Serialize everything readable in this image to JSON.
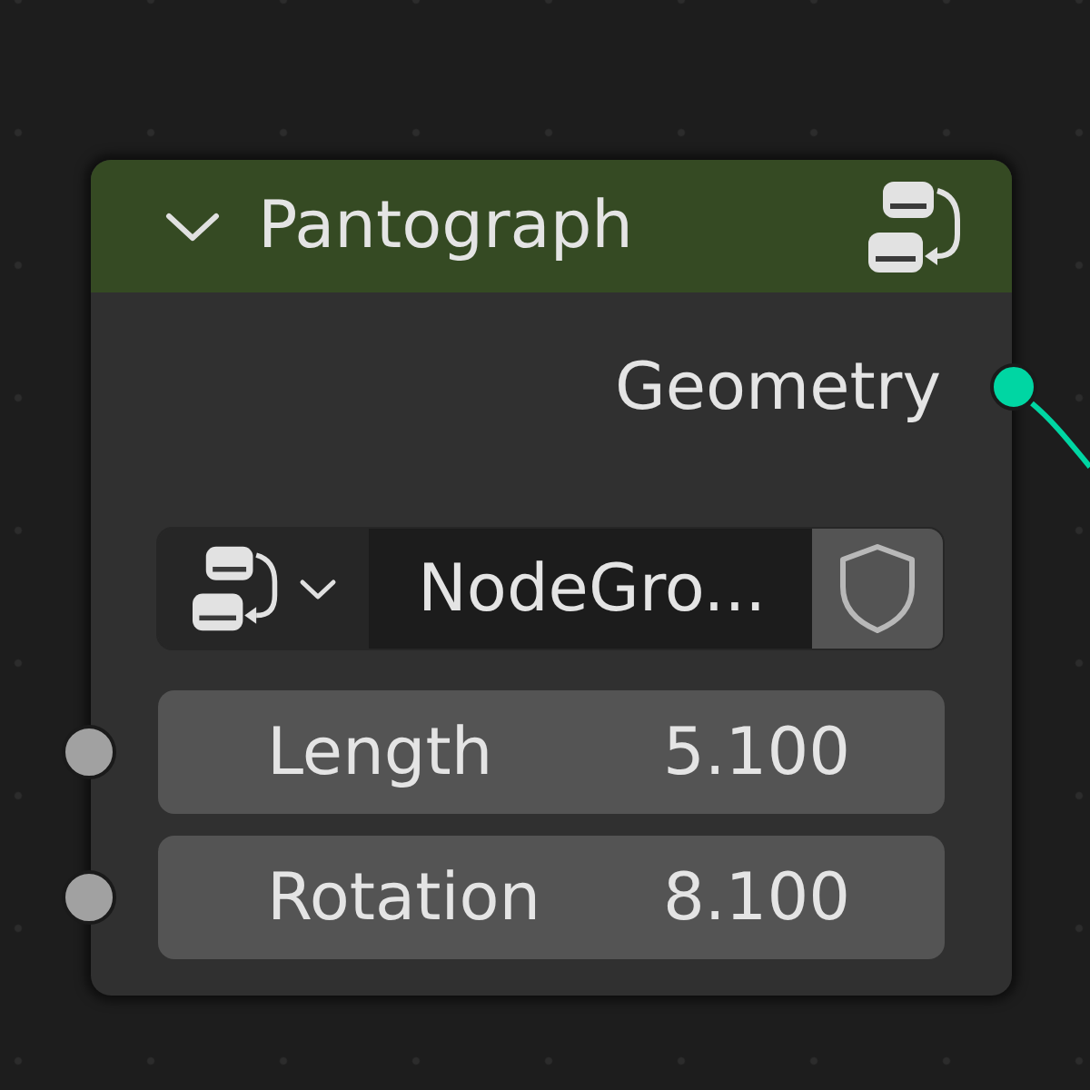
{
  "node": {
    "title": "Pantograph",
    "expanded": true,
    "outputs": [
      {
        "name": "Geometry",
        "color": "#00d6a3",
        "linked": true
      }
    ],
    "group_selector": {
      "value": "NodeGro..."
    },
    "inputs": [
      {
        "name": "Length",
        "value": "5.100",
        "color": "#a1a1a1"
      },
      {
        "name": "Rotation",
        "value": "8.100",
        "color": "#a1a1a1"
      }
    ]
  }
}
